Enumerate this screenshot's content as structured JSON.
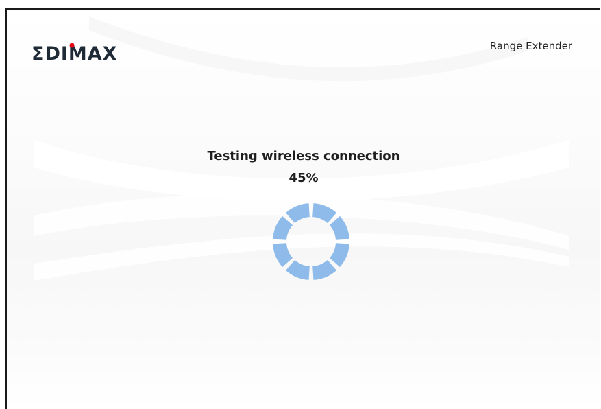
{
  "brand": {
    "logo_text": "EDIMAX",
    "accent_dot_color": "#e60012",
    "logo_color": "#1f2a37"
  },
  "header": {
    "product_name": "Range Extender"
  },
  "status": {
    "title": "Testing wireless connection",
    "progress_label": "45%",
    "progress_fraction": 0.45
  },
  "spinner": {
    "icon": "loading-spinner-icon",
    "color": "#8ebbea"
  }
}
